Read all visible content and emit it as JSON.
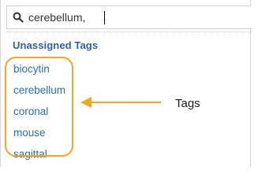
{
  "search": {
    "value": "cerebellum,",
    "icon": "search-icon"
  },
  "section": {
    "heading": "Unassigned Tags"
  },
  "tags": [
    {
      "label": "biocytin"
    },
    {
      "label": "cerebellum"
    },
    {
      "label": "coronal"
    },
    {
      "label": "mouse"
    },
    {
      "label": "sagittal"
    }
  ],
  "annotation": {
    "label": "Tags",
    "color": "#f5a623"
  },
  "colors": {
    "heading": "#2f5fa5",
    "tag_link": "#2a6fb7"
  }
}
